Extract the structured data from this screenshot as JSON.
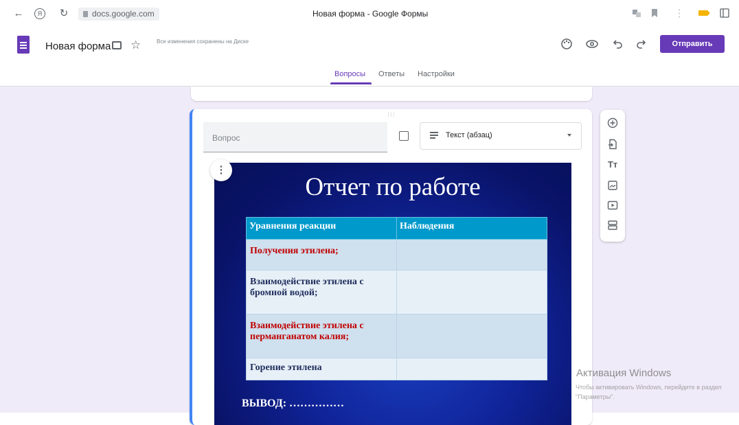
{
  "browser": {
    "url": "docs.google.com",
    "tab_title": "Новая форма - Google Формы"
  },
  "header": {
    "doc_title": "Новая форма",
    "save_status": "Все изменения сохранены на Диске",
    "send_label": "Отправить"
  },
  "tabs": [
    {
      "label": "Вопросы",
      "active": true
    },
    {
      "label": "Ответы",
      "active": false
    },
    {
      "label": "Настройки",
      "active": false
    }
  ],
  "question": {
    "placeholder": "Вопрос",
    "type_label": "Текст (абзац)",
    "drag_handle": "⁝⁝⁝"
  },
  "slide": {
    "title": "Отчет по работе",
    "table_headers": [
      "Уравнения реакции",
      "Наблюдения"
    ],
    "rows": [
      {
        "text": "Получения этилена;",
        "color": "#c00000"
      },
      {
        "text": "Взаимодействие этилена с бромной водой;",
        "color": "#1f2d5c"
      },
      {
        "text": "Взаимодействие этилена с перманганатом калия;",
        "color": "#c00000"
      },
      {
        "text": "Горение этилена",
        "color": "#1f2d5c"
      }
    ],
    "conclusion": "ВЫВОД: ……………"
  },
  "toolbar": {
    "icons": [
      "add-question-icon",
      "import-questions-icon",
      "add-title-icon",
      "add-image-icon",
      "add-video-icon",
      "add-section-icon"
    ]
  },
  "watermark": {
    "title": "Активация Windows",
    "subtitle": "Чтобы активировать Windows, перейдите в раздел \"Параметры\"."
  },
  "colors": {
    "accent": "#673ab7",
    "page_bg": "#f0ebf8",
    "focus_border": "#4285f4"
  }
}
